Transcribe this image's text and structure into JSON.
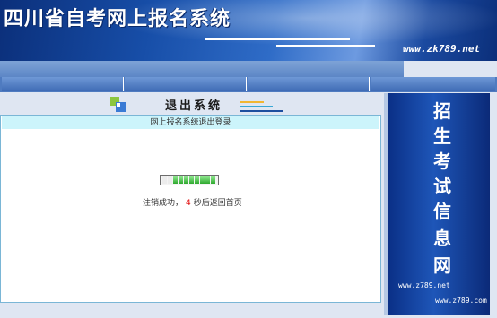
{
  "header": {
    "title": "四川省自考网上报名系统",
    "url": "www.zk789.net"
  },
  "section": {
    "title": "退出系统"
  },
  "panel": {
    "title": "网上报名系统退出登录",
    "progress_fraction": 0.8,
    "message_prefix": "注销成功，",
    "countdown": "4",
    "message_suffix": "秒后返回首页"
  },
  "side_banner": {
    "chars": [
      "招",
      "生",
      "考",
      "试",
      "信",
      "息",
      "网"
    ],
    "url_1": "www.z789.net",
    "url_2": "www.z789.com"
  },
  "colors": {
    "header_blue": "#174ea8",
    "panel_head_bg": "#ccf4fb",
    "countdown_red": "#e00000"
  }
}
